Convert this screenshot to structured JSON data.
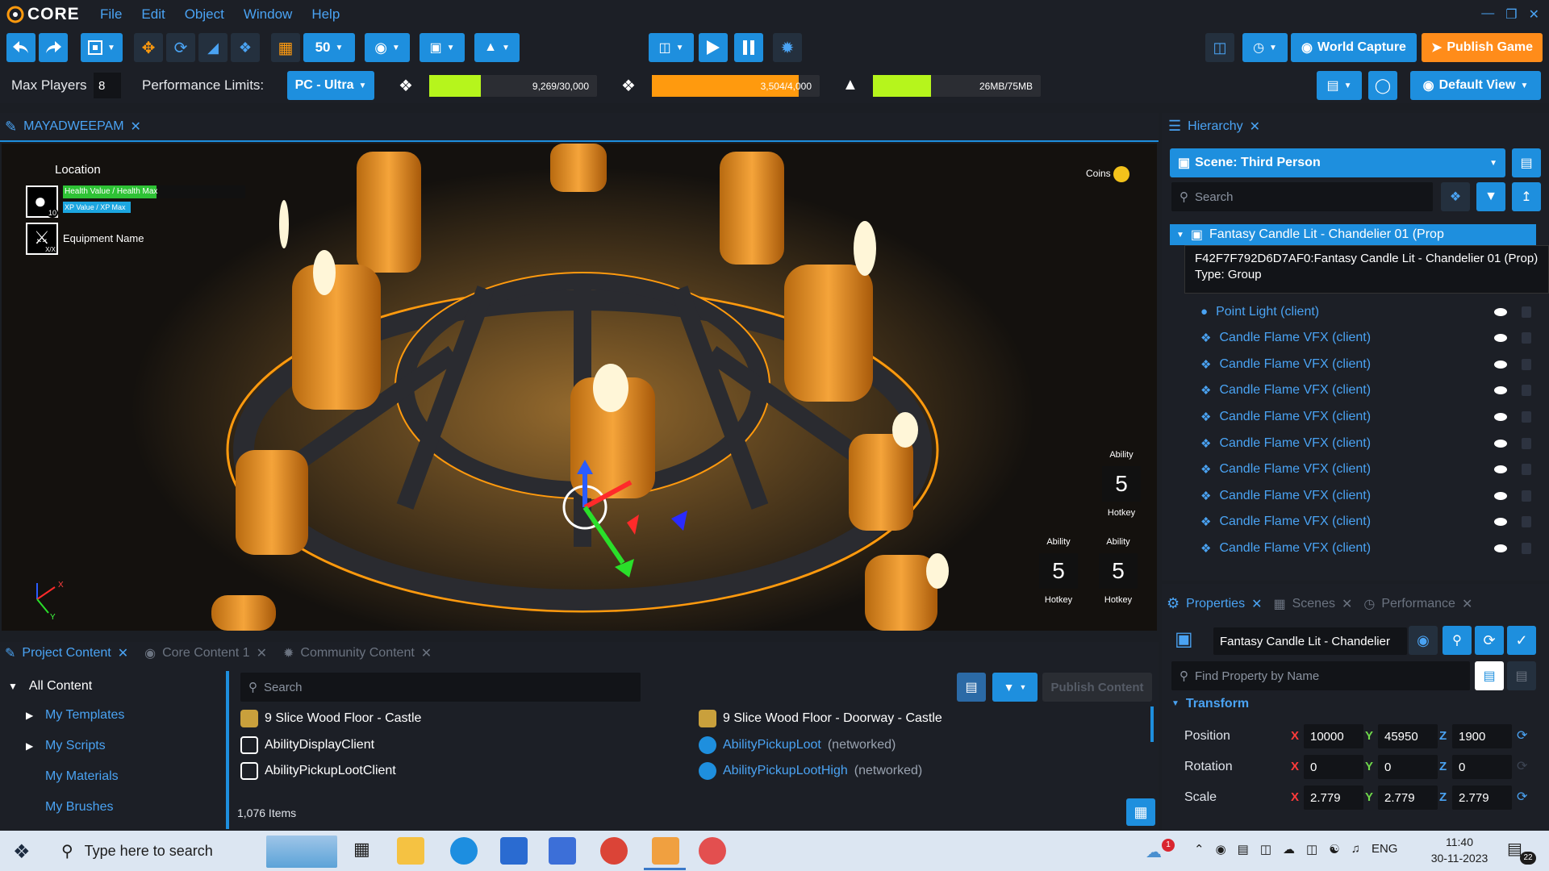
{
  "app": {
    "logo_text": "CORE"
  },
  "menu": [
    "File",
    "Edit",
    "Object",
    "Window",
    "Help"
  ],
  "toolbar": {
    "grid_size": "50",
    "world_capture": "World Capture",
    "publish_game": "Publish Game"
  },
  "perf": {
    "max_players_label": "Max Players",
    "max_players_value": "8",
    "limits_label": "Performance Limits:",
    "limits_value": "PC - Ultra",
    "objects": {
      "text": "9,269/30,000",
      "fraction": 0.309,
      "color": "#b6f51c"
    },
    "networked": {
      "text": "3,504/4,000",
      "fraction": 0.876,
      "color": "#ff9a0e"
    },
    "memory": {
      "text": "26MB/75MB",
      "fraction": 0.347,
      "color": "#b6f51c"
    },
    "default_view": "Default View"
  },
  "viewport": {
    "tab_label": "MAYADWEEPAM",
    "hud": {
      "location": "Location",
      "health": "Health Value / Health Max",
      "xp": "XP Value / XP Max",
      "level": "10",
      "equipment": "Equipment Name",
      "equipment_count": "X/X",
      "coins": "Coins",
      "abilities": [
        {
          "label": "Ability",
          "num": "5",
          "hotkey": "Hotkey"
        },
        {
          "label": "Ability",
          "num": "5",
          "hotkey": "Hotkey"
        },
        {
          "label": "Ability",
          "num": "5",
          "hotkey": "Hotkey"
        }
      ]
    },
    "axes": {
      "x": "X",
      "y": "Y"
    }
  },
  "hierarchy": {
    "tab_label": "Hierarchy",
    "scene_label": "Scene: Third Person",
    "search_placeholder": "Search",
    "selected_row": "Fantasy Candle Lit - Chandelier 01 (Prop",
    "tooltip_line1": "F42F7F792D6D7AF0:Fantasy Candle Lit - Chandelier 01 (Prop)",
    "tooltip_line2": "Type: Group",
    "rows": [
      {
        "label": "Point Light (client)",
        "icon": "lightbulb-icon"
      },
      {
        "label": "Candle Flame VFX (client)",
        "icon": "cube-icon"
      },
      {
        "label": "Candle Flame VFX (client)",
        "icon": "cube-icon"
      },
      {
        "label": "Candle Flame VFX (client)",
        "icon": "cube-icon"
      },
      {
        "label": "Candle Flame VFX (client)",
        "icon": "cube-icon"
      },
      {
        "label": "Candle Flame VFX (client)",
        "icon": "cube-icon"
      },
      {
        "label": "Candle Flame VFX (client)",
        "icon": "cube-icon"
      },
      {
        "label": "Candle Flame VFX (client)",
        "icon": "cube-icon"
      },
      {
        "label": "Candle Flame VFX (client)",
        "icon": "cube-icon"
      },
      {
        "label": "Candle Flame VFX (client)",
        "icon": "cube-icon"
      }
    ]
  },
  "properties": {
    "tabs": [
      "Properties",
      "Scenes",
      "Performance"
    ],
    "object_name": "Fantasy Candle Lit - Chandelier",
    "find_placeholder": "Find Property by Name",
    "transform_label": "Transform",
    "position": {
      "label": "Position",
      "x": "10000",
      "y": "45950",
      "z": "1900"
    },
    "rotation": {
      "label": "Rotation",
      "x": "0",
      "y": "0",
      "z": "0"
    },
    "scale": {
      "label": "Scale",
      "x": "2.779",
      "y": "2.779",
      "z": "2.779"
    },
    "axis_x": "X",
    "axis_y": "Y",
    "axis_z": "Z"
  },
  "content": {
    "tabs": [
      "Project Content",
      "Core Content 1",
      "Community Content"
    ],
    "tree": {
      "root": "All Content",
      "items": [
        "My Templates",
        "My Scripts",
        "My Materials",
        "My Brushes"
      ]
    },
    "search_placeholder": "Search",
    "publish_label": "Publish Content",
    "files_left": [
      {
        "name": "9 Slice Wood Floor - Castle",
        "net": "",
        "icon": "template-icon"
      },
      {
        "name": "AbilityDisplayClient",
        "net": "",
        "icon": "script-icon"
      },
      {
        "name": "AbilityPickupLootClient",
        "net": "",
        "icon": "script-icon"
      }
    ],
    "files_right": [
      {
        "name": "9 Slice Wood Floor - Doorway - Castle",
        "net": "",
        "icon": "template-icon"
      },
      {
        "name": "AbilityPickupLoot",
        "net": "(networked)",
        "icon": "networked-template-icon"
      },
      {
        "name": "AbilityPickupLootHigh",
        "net": "(networked)",
        "icon": "networked-template-icon"
      }
    ],
    "item_count": "1,076 Items"
  },
  "taskbar": {
    "search_placeholder": "Type here to search",
    "time": "11:40",
    "date": "30-11-2023",
    "lang": "ENG",
    "notif_count": "22",
    "weather_badge": "1"
  },
  "colors": {
    "accent": "#1e8fde",
    "link": "#4aa3f3",
    "publish": "#ff8c1a"
  }
}
